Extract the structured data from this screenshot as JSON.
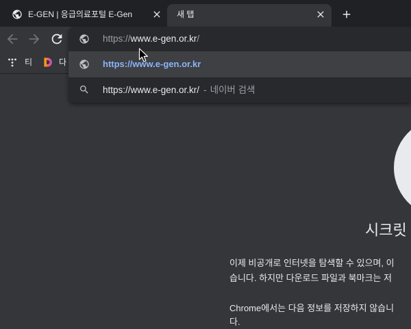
{
  "colors": {
    "tabstrip_bg": "#202124",
    "toolbar_bg": "#35363a",
    "page_bg": "#35363a",
    "dropdown_bg": "#28292c",
    "dropdown_selected_bg": "#3f4044",
    "text_primary": "#e8eaed",
    "text_secondary": "#9aa0a6",
    "link_blue": "#8ab4f8",
    "icon_disabled": "#6f7276",
    "circle_fill": "#e8eaed"
  },
  "tabs": [
    {
      "title": "E-GEN | 응급의료포털 E-Gen",
      "icon": "globe-icon",
      "close_icon": "close-icon",
      "active": false
    },
    {
      "title": "새 탭",
      "close_icon": "close-icon",
      "active": true
    }
  ],
  "new_tab_icon": "plus-icon",
  "toolbar": {
    "back_icon": "arrow-back-icon",
    "back_enabled": false,
    "forward_icon": "arrow-forward-icon",
    "forward_enabled": false,
    "reload_icon": "reload-icon"
  },
  "omnibox": {
    "icon": "globe-icon",
    "value": {
      "scheme": "https://",
      "host": "www.e-gen.or.kr",
      "path": "/"
    },
    "suggestions": [
      {
        "icon": "globe-icon",
        "text": "https://www.e-gen.or.kr",
        "selected": true
      },
      {
        "icon": "search-icon",
        "text": "https://www.e-gen.or.kr/",
        "separator": "-",
        "description": "네이버 검색",
        "selected": false
      }
    ]
  },
  "bookmarks": [
    {
      "icon": "dots-favicon-icon",
      "label": "티"
    },
    {
      "icon": "d-logo-icon",
      "logo_letter": "D",
      "label": "다"
    }
  ],
  "incognito_page": {
    "icon": "incognito-circle-icon",
    "title": "시크릿",
    "paragraph1": [
      "이제 비공개로 인터넷을 탐색할 수 있으며, 이",
      "습니다. 하지만 다운로드 파일과 북마크는 저"
    ],
    "paragraph2": [
      "Chrome에서는 다음 정보를 저장하지 않습니",
      "다."
    ]
  },
  "cursor": {
    "icon": "mouse-pointer-icon"
  }
}
